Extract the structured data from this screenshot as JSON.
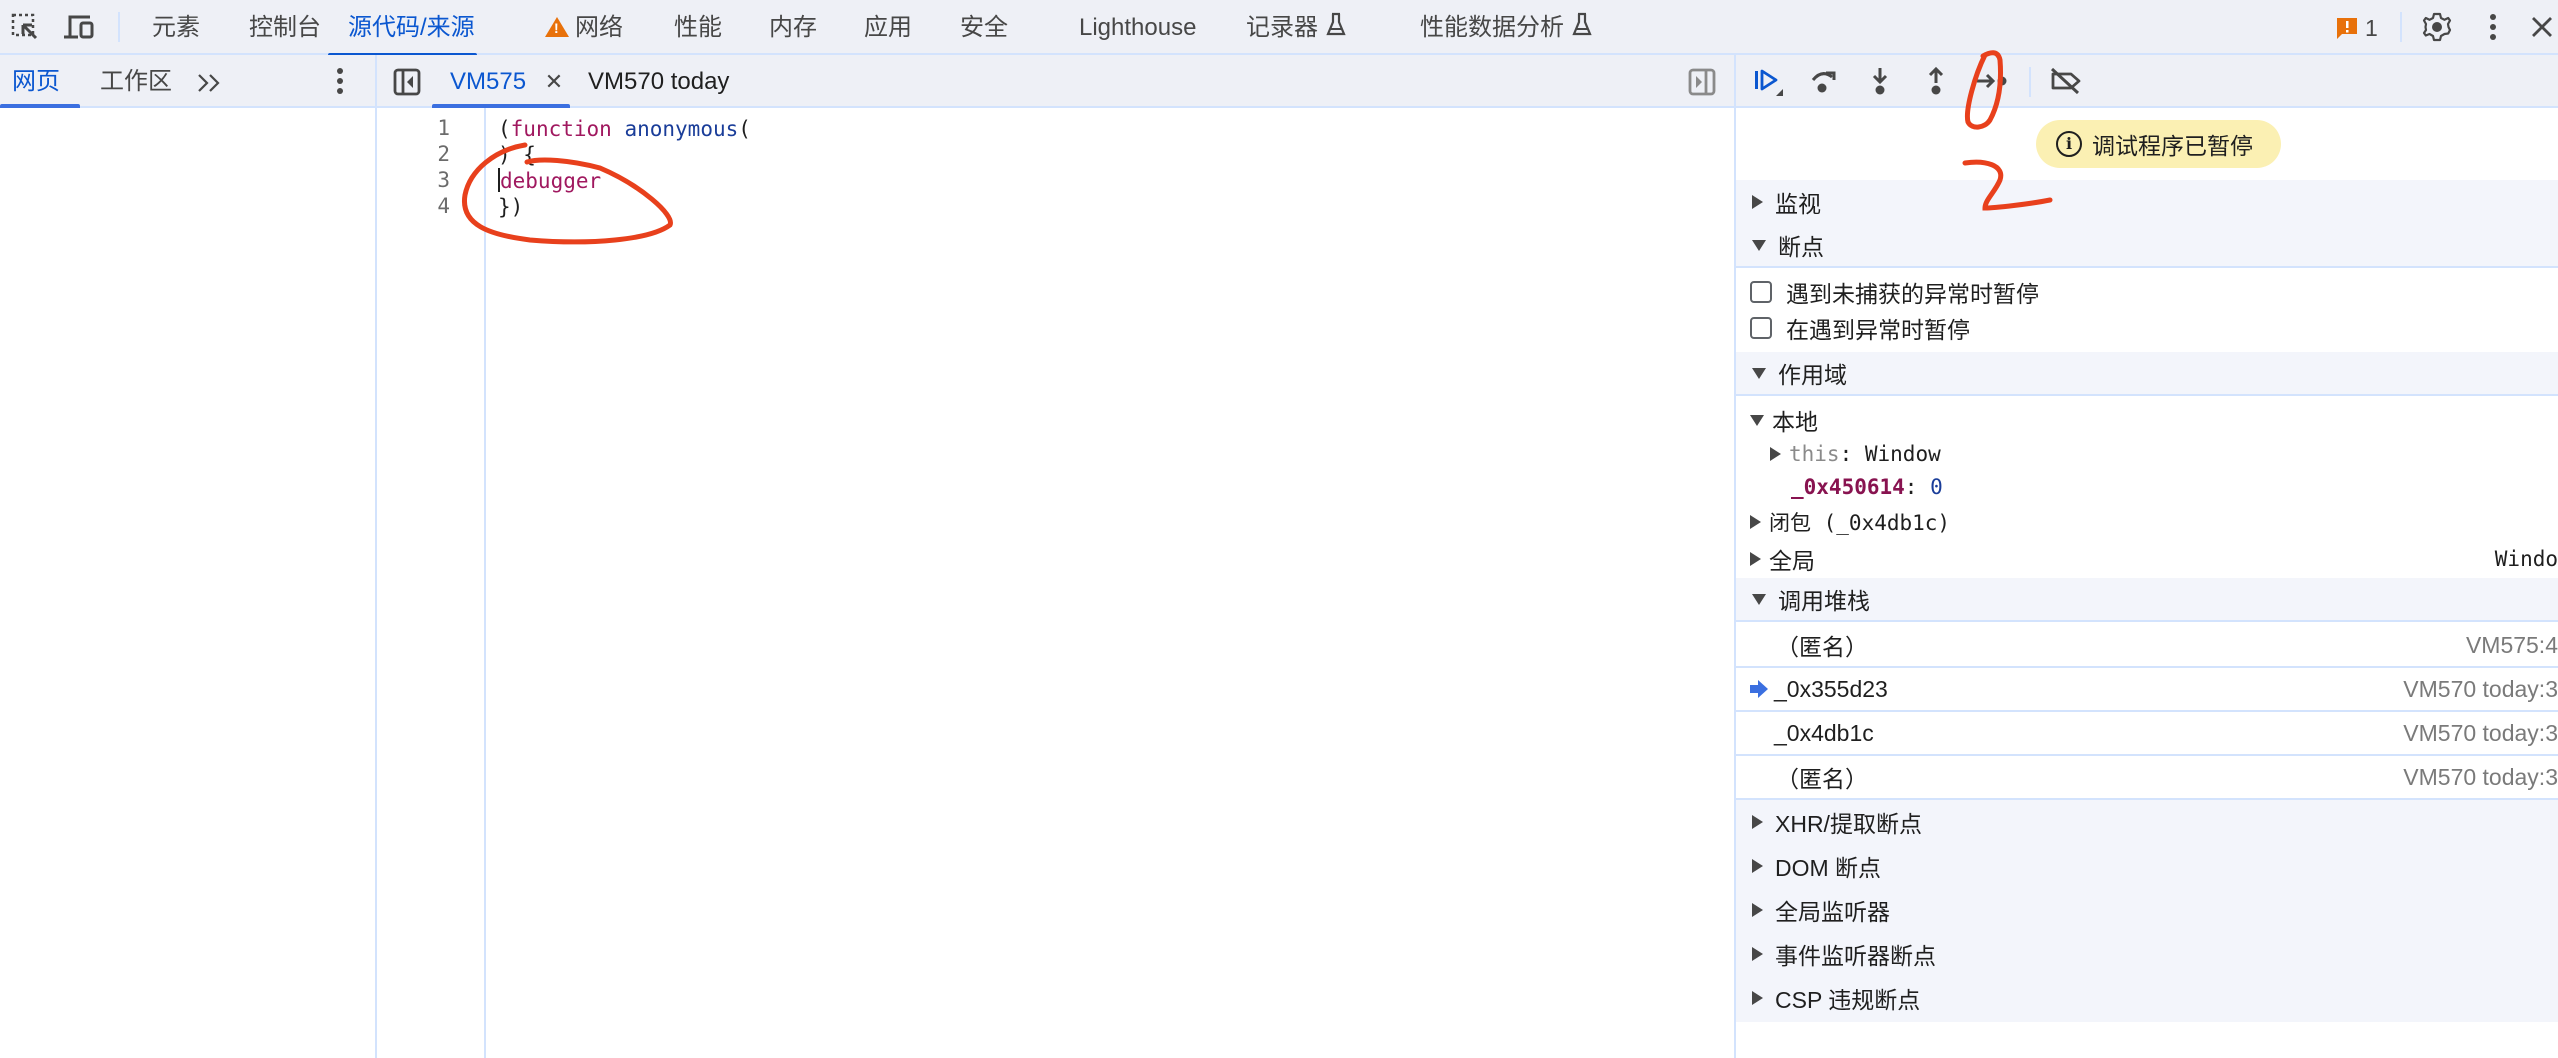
{
  "toolbar": {
    "inspect_icon": "inspect-element-icon",
    "device_icon": "device-toggle-icon",
    "tabs": [
      {
        "label": "元素",
        "active": false
      },
      {
        "label": "控制台",
        "active": false
      },
      {
        "label": "源代码/来源",
        "active": true
      },
      {
        "label": "网络",
        "active": false,
        "warning": true
      },
      {
        "label": "性能",
        "active": false
      },
      {
        "label": "内存",
        "active": false
      },
      {
        "label": "应用",
        "active": false
      },
      {
        "label": "安全",
        "active": false
      },
      {
        "label": "Lighthouse",
        "active": false
      },
      {
        "label": "记录器",
        "active": false,
        "experimental": true
      },
      {
        "label": "性能数据分析",
        "active": false,
        "experimental": true
      }
    ],
    "issues_count": "1",
    "issues_color": "#e8710a"
  },
  "navigator": {
    "tabs": [
      {
        "label": "网页",
        "active": true
      },
      {
        "label": "工作区",
        "active": false
      }
    ],
    "more_label": "≫"
  },
  "editor": {
    "tabs": [
      {
        "label": "VM575",
        "active": true,
        "closable": true
      },
      {
        "label": "VM570 today",
        "active": false
      }
    ],
    "close_glyph": "✕",
    "lines": [
      {
        "number": "1",
        "tokens": [
          {
            "t": "(",
            "c": "punc"
          },
          {
            "t": "function",
            "c": "kw"
          },
          {
            "t": " ",
            "c": "punc"
          },
          {
            "t": "anonymous",
            "c": "fn"
          },
          {
            "t": "(",
            "c": "punc"
          }
        ]
      },
      {
        "number": "2",
        "tokens": [
          {
            "t": ") {",
            "c": "punc"
          }
        ]
      },
      {
        "number": "3",
        "tokens": [
          {
            "t": "debugger",
            "c": "kw"
          }
        ]
      },
      {
        "number": "4",
        "tokens": [
          {
            "t": "})",
            "c": "punc"
          }
        ]
      }
    ]
  },
  "debugger": {
    "paused_message": "调试程序已暂停",
    "sections": {
      "watch": "监视",
      "breakpoints": "断点",
      "scope": "作用域",
      "call_stack": "调用堆栈",
      "xhr": "XHR/提取断点",
      "dom": "DOM 断点",
      "global_listeners": "全局监听器",
      "event_listener_bp": "事件监听器断点",
      "csp": "CSP 违规断点"
    },
    "pause_options": [
      {
        "label": "遇到未捕获的异常时暂停",
        "checked": false
      },
      {
        "label": "在遇到异常时暂停",
        "checked": false
      }
    ],
    "scope": {
      "local_label": "本地",
      "this_key": "this",
      "this_value": "Window",
      "var_key": "_0x450614",
      "var_value": "0",
      "closure_label": "闭包 (_0x4db1c)",
      "global_label": "全局",
      "global_value": "Windo"
    },
    "call_stack": [
      {
        "name": "（匿名）",
        "location": "VM575:4",
        "current": false
      },
      {
        "name": "_0x355d23",
        "location": "VM570 today:3",
        "current": true
      },
      {
        "name": "_0x4db1c",
        "location": "VM570 today:3",
        "current": false
      },
      {
        "name": "（匿名）",
        "location": "VM570 today:3",
        "current": false
      }
    ]
  },
  "annotations": {
    "number_2": "2",
    "color": "#e8401c"
  }
}
